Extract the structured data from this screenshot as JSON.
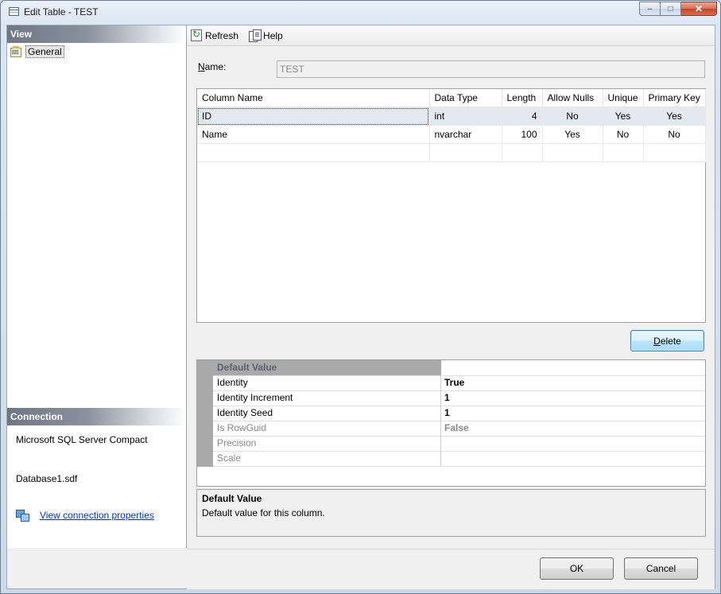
{
  "window": {
    "title": "Edit Table - TEST",
    "buttons": {
      "minimize": "–",
      "maximize": "□",
      "close": "✕"
    }
  },
  "left": {
    "view_header": "View",
    "nav_items": [
      {
        "label": "General",
        "icon": "page-properties-icon"
      }
    ],
    "connection_header": "Connection",
    "connection_server": "Microsoft SQL Server Compact",
    "connection_db": "Database1.sdf",
    "connection_link": "View connection properties"
  },
  "toolbar": {
    "refresh": "Refresh",
    "help": "Help"
  },
  "name_field": {
    "label_prefix": "N",
    "label_rest": "ame:",
    "value": "TEST"
  },
  "columns_grid": {
    "headers": [
      "Column Name",
      "Data Type",
      "Length",
      "Allow Nulls",
      "Unique",
      "Primary Key"
    ],
    "rows": [
      [
        "ID",
        "int",
        "4",
        "No",
        "Yes",
        "Yes"
      ],
      [
        "Name",
        "nvarchar",
        "100",
        "Yes",
        "No",
        "No"
      ],
      [
        "",
        "",
        "",
        "",
        "",
        ""
      ]
    ]
  },
  "delete_button": {
    "prefix": "D",
    "rest": "elete"
  },
  "properties": [
    {
      "name": "Default Value",
      "value": "",
      "state": "header"
    },
    {
      "name": "Identity",
      "value": "True",
      "state": "normal"
    },
    {
      "name": "Identity Increment",
      "value": "1",
      "state": "normal"
    },
    {
      "name": "Identity Seed",
      "value": "1",
      "state": "normal"
    },
    {
      "name": "Is RowGuid",
      "value": "False",
      "state": "disabled"
    },
    {
      "name": "Precision",
      "value": "",
      "state": "disabled"
    },
    {
      "name": "Scale",
      "value": "",
      "state": "disabled"
    }
  ],
  "description": {
    "title": "Default Value",
    "text": "Default value for this column."
  },
  "footer": {
    "ok": "OK",
    "cancel": "Cancel"
  }
}
